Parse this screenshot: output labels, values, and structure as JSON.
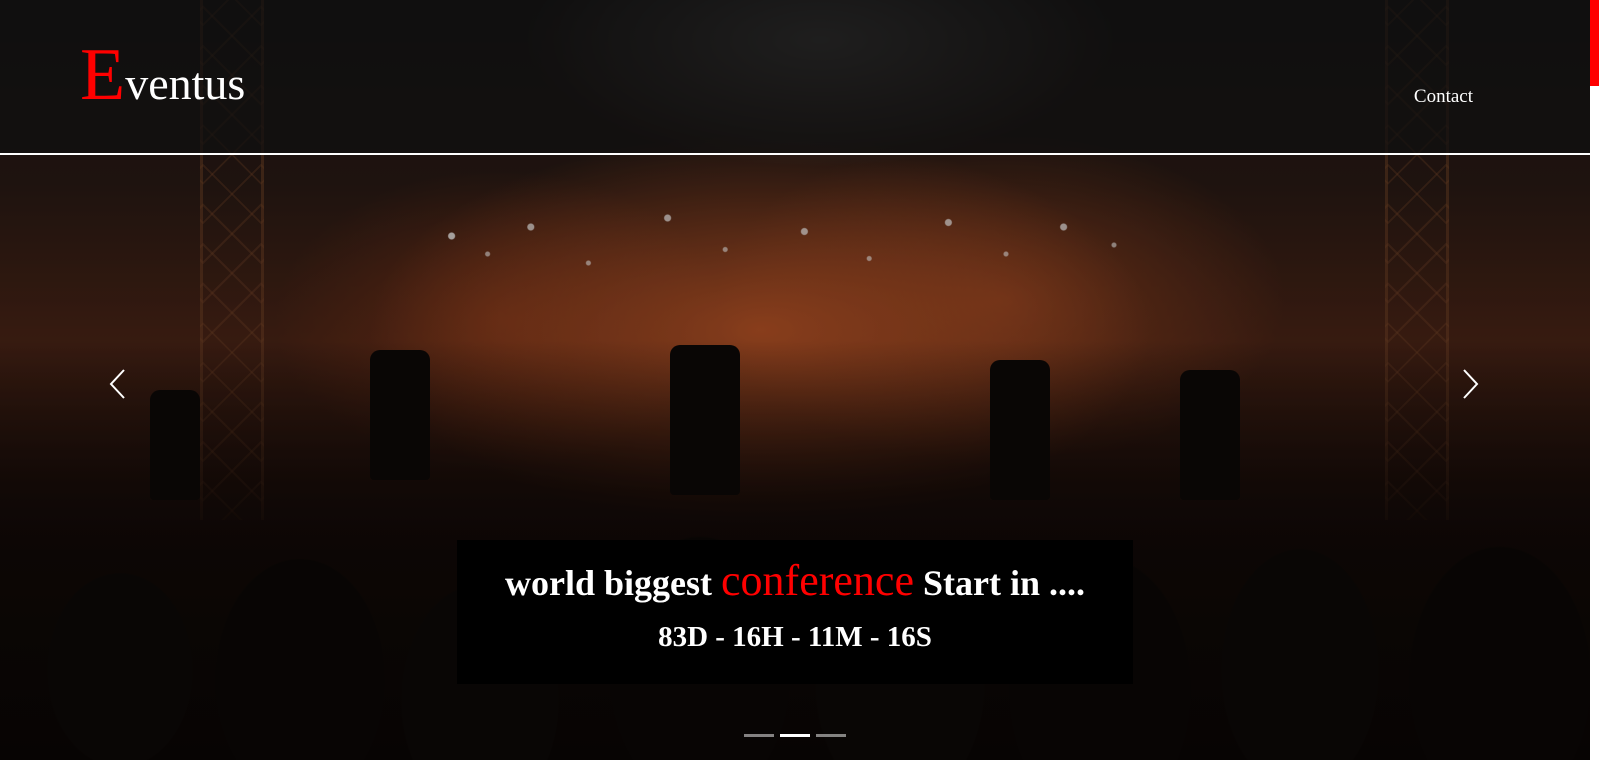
{
  "brand": {
    "initial": "E",
    "rest": "ventus",
    "accent_color": "#ff0000"
  },
  "nav": {
    "contact_label": "Contact"
  },
  "carousel": {
    "prev_icon": "chevron-left-icon",
    "next_icon": "chevron-right-icon",
    "slide_count": 3,
    "active_slide": 2
  },
  "countdown": {
    "headline_before": "world biggest ",
    "headline_accent": "conference",
    "headline_after": " Start in ....",
    "timer": "83D - 16H - 11M - 16S"
  },
  "scrollbar": {
    "thumb_color": "#ff0000",
    "track_color": "#ffffff"
  }
}
